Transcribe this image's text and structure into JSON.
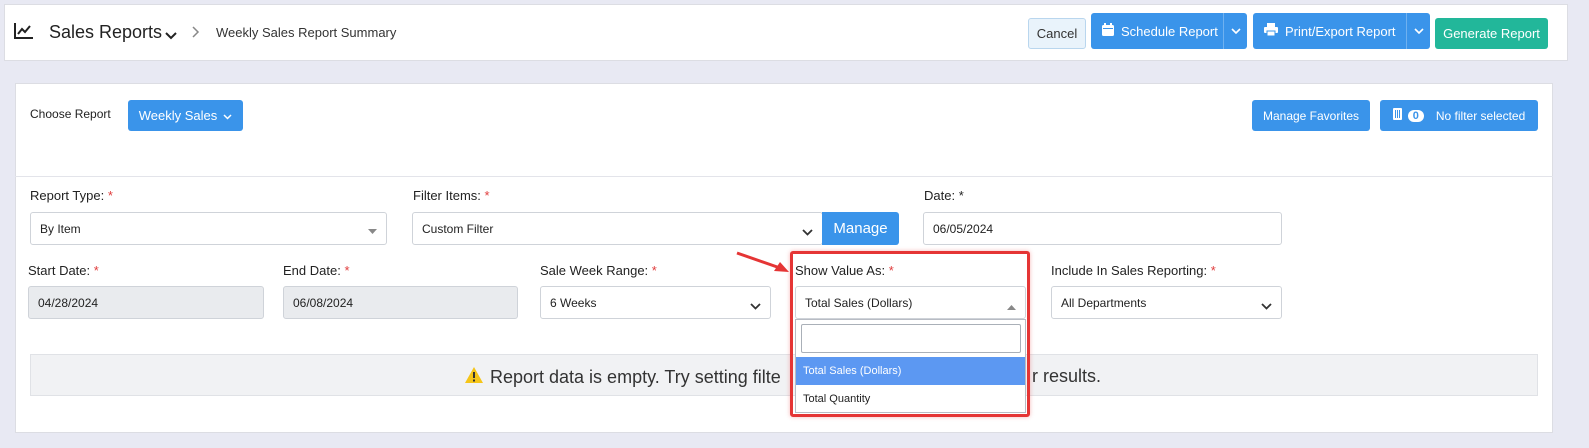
{
  "header": {
    "title": "Sales Reports",
    "breadcrumb": "Weekly Sales Report Summary",
    "cancel_label": "Cancel",
    "schedule_label": "Schedule Report",
    "print_label": "Print/Export Report",
    "generate_label": "Generate Report"
  },
  "report_chooser": {
    "label": "Choose Report",
    "selected": "Weekly Sales",
    "manage_favorites_label": "Manage Favorites",
    "filter_count": "0",
    "filter_status": "No filter selected"
  },
  "form": {
    "report_type": {
      "label": "Report Type:",
      "value": "By Item"
    },
    "filter_items": {
      "label": "Filter Items:",
      "value": "Custom Filter",
      "manage_label": "Manage"
    },
    "date": {
      "label": "Date:",
      "value": "06/05/2024"
    },
    "start_date": {
      "label": "Start Date:",
      "value": "04/28/2024"
    },
    "end_date": {
      "label": "End Date:",
      "value": "06/08/2024"
    },
    "sale_week_range": {
      "label": "Sale Week Range:",
      "value": "6 Weeks"
    },
    "show_value_as": {
      "label": "Show Value As:",
      "value": "Total Sales (Dollars)",
      "options": [
        "Total Sales (Dollars)",
        "Total Quantity"
      ],
      "search_value": ""
    },
    "include_in_sales_reporting": {
      "label": "Include In Sales Reporting:",
      "value": "All Departments"
    },
    "required_mark": "*"
  },
  "warning": {
    "text_left": "Report data is empty. Try setting filte",
    "text_right": "r results."
  },
  "colors": {
    "primary": "#3a94ea",
    "teal": "#22b79a",
    "required": "#e03c3c",
    "highlight": "#e53535",
    "warning_icon": "#f5c518"
  }
}
